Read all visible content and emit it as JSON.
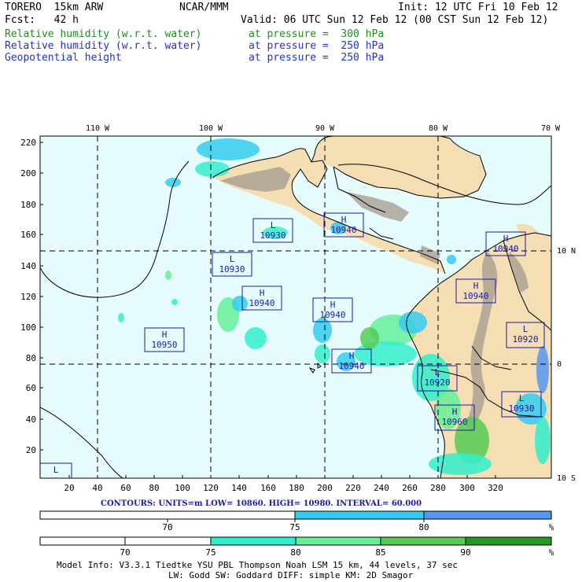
{
  "header": {
    "model": "TORERO  15km ARW",
    "org": "NCAR/MMM",
    "init": "Init: 12 UTC Fri 10 Feb 12",
    "fcst": "Fcst:   42 h",
    "valid": "Valid: 06 UTC Sun 12 Feb 12 (00 CST Sun 12 Feb 12)",
    "fields": [
      {
        "name": "Relative humidity (w.r.t. water)",
        "level": "at pressure =  300 hPa",
        "color": "#1e8f1e"
      },
      {
        "name": "Relative humidity (w.r.t. water)",
        "level": "at pressure =  250 hPa",
        "color": "#2233cc"
      },
      {
        "name": "Geopotential height",
        "level": "at pressure =  250 hPa",
        "color": "#2233cc"
      }
    ]
  },
  "map": {
    "lon_labels": [
      "110 W",
      "100 W",
      "90 W",
      "80 W",
      "70 W"
    ],
    "lat_labels": [
      "10 N",
      "0",
      "10 S"
    ],
    "y_ticks": [
      "220",
      "200",
      "180",
      "160",
      "140",
      "120",
      "100",
      "80",
      "60",
      "40",
      "20"
    ],
    "x_ticks": [
      "20",
      "40",
      "60",
      "80",
      "100",
      "120",
      "140",
      "160",
      "180",
      "200",
      "220",
      "240",
      "260",
      "280",
      "300",
      "320"
    ],
    "ocean_color": "#e6fcfc",
    "land_color": "#f5deb3",
    "terrain_color": "#a89f92",
    "centers": [
      {
        "type": "L",
        "value": "10930"
      },
      {
        "type": "H",
        "value": "10940"
      },
      {
        "type": "L",
        "value": "10930"
      },
      {
        "type": "H",
        "value": "10940"
      },
      {
        "type": "H",
        "value": "10940"
      },
      {
        "type": "H",
        "value": "10950"
      },
      {
        "type": "H",
        "value": "10940"
      },
      {
        "type": "H",
        "value": "10940"
      },
      {
        "type": "H",
        "value": "10940"
      },
      {
        "type": "L",
        "value": "10920"
      },
      {
        "type": "L",
        "value": "10920"
      },
      {
        "type": "H",
        "value": "10960"
      },
      {
        "type": "L",
        "value": "10930"
      },
      {
        "type": "L",
        "value": ""
      }
    ]
  },
  "contours": {
    "text": "CONTOURS:  UNITS=m  LOW=  10860.     HIGH=  10980.     INTERVAL=  60.000"
  },
  "colorbar1": {
    "colors": [
      "#ffffff",
      "#33ccee",
      "#5599ee"
    ],
    "labels": [
      "70",
      "75",
      "80",
      "%"
    ]
  },
  "colorbar2": {
    "colors": [
      "#ffffff",
      "#ffffff",
      "#33eecc",
      "#66ee99",
      "#55cc55",
      "#229922"
    ],
    "labels": [
      "70",
      "75",
      "80",
      "85",
      "90",
      "%"
    ]
  },
  "footer": {
    "line1": "Model Info: V3.3.1    Tiedtke YSU PBL  Thompson     Noah LSM  15 km,   44 levels,   37 sec",
    "line2": "LW: Godd SW: Goddard DIFF: simple KM: 2D Smagor"
  }
}
